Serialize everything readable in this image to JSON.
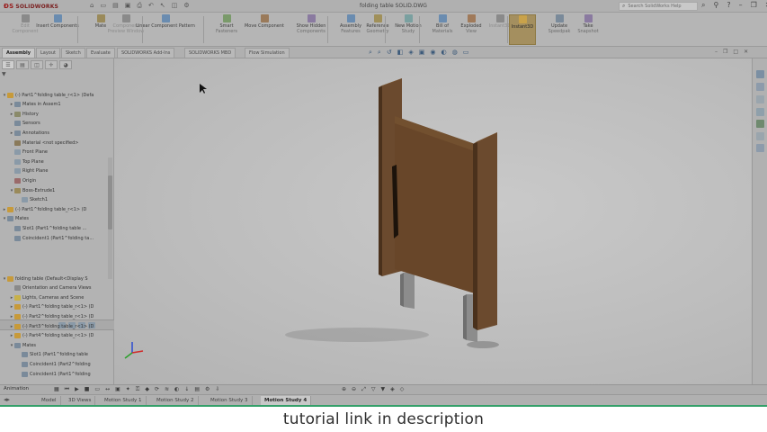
{
  "app": {
    "brand": "SOLIDWORKS",
    "document_title": "folding table SOLID.DWG"
  },
  "search": {
    "placeholder": "Search SolidWorks Help"
  },
  "ribbon": {
    "tools": [
      {
        "label": "Edit",
        "sub": "Component",
        "icon": "edit-component-icon",
        "dim": true
      },
      {
        "label": "Insert Components",
        "sub": "",
        "icon": "insert-components-icon"
      },
      {
        "label": "Mate",
        "sub": "",
        "icon": "mate-icon"
      },
      {
        "label": "Component",
        "sub": "Preview Window",
        "icon": "component-preview-icon",
        "dim": true
      },
      {
        "label": "Linear Component Pattern",
        "sub": "",
        "icon": "linear-pattern-icon"
      },
      {
        "label": "Smart",
        "sub": "Fasteners",
        "icon": "smart-fasteners-icon"
      },
      {
        "label": "Move Component",
        "sub": "",
        "icon": "move-component-icon"
      },
      {
        "label": "Show Hidden",
        "sub": "Components",
        "icon": "show-hidden-icon"
      },
      {
        "label": "Assembly",
        "sub": "Features",
        "icon": "assembly-features-icon"
      },
      {
        "label": "Reference",
        "sub": "Geometry",
        "icon": "reference-geometry-icon"
      },
      {
        "label": "New Motion",
        "sub": "Study",
        "icon": "new-motion-study-icon"
      },
      {
        "label": "Bill of",
        "sub": "Materials",
        "icon": "bom-icon"
      },
      {
        "label": "Exploded",
        "sub": "View",
        "icon": "exploded-view-icon"
      },
      {
        "label": "Instant3D",
        "sub": "",
        "icon": "instant3d-icon",
        "dim": true
      },
      {
        "label": "Instant3D",
        "sub": "",
        "icon": "instant3d-active-icon",
        "active": true
      },
      {
        "label": "Update",
        "sub": "Speedpak",
        "icon": "speedpak-icon"
      },
      {
        "label": "Take",
        "sub": "Snapshot",
        "icon": "snapshot-icon"
      }
    ]
  },
  "command_tabs": [
    "Assembly",
    "Layout",
    "Sketch",
    "Evaluate",
    "SOLIDWORKS Add-Ins",
    "SOLIDWORKS MBD",
    "Flow Simulation"
  ],
  "active_command_tab": "Assembly",
  "feature_tree": [
    {
      "label": "(-) Part1^folding table_r<1> (Defa",
      "level": 0,
      "exp": "▾",
      "icon": "#c79a3a"
    },
    {
      "label": "Mates in Assem1",
      "level": 1,
      "exp": "▸",
      "icon": "#7a8a9a"
    },
    {
      "label": "History",
      "level": 1,
      "exp": "▸",
      "icon": "#8a8a6a"
    },
    {
      "label": "Sensors",
      "level": 1,
      "exp": "",
      "icon": "#7a8a9a"
    },
    {
      "label": "Annotations",
      "level": 1,
      "exp": "▸",
      "icon": "#7a8a9a"
    },
    {
      "label": "Material <not specified>",
      "level": 1,
      "exp": "",
      "icon": "#8a7a5a"
    },
    {
      "label": "Front Plane",
      "level": 1,
      "exp": "",
      "icon": "#8a9aa8"
    },
    {
      "label": "Top Plane",
      "level": 1,
      "exp": "",
      "icon": "#8a9aa8"
    },
    {
      "label": "Right Plane",
      "level": 1,
      "exp": "",
      "icon": "#8a9aa8"
    },
    {
      "label": "Origin",
      "level": 1,
      "exp": "",
      "icon": "#9a6a6a"
    },
    {
      "label": "Boss-Extrude1",
      "level": 1,
      "exp": "▾",
      "icon": "#9a8a5a"
    },
    {
      "label": "Sketch1",
      "level": 2,
      "exp": "",
      "icon": "#8a9aa8"
    },
    {
      "label": "(-) Part1^folding table_r<1> (D",
      "level": 0,
      "exp": "▸",
      "icon": "#c79a3a"
    },
    {
      "label": "Mates",
      "level": 0,
      "exp": "▾",
      "icon": "#7a8a9a"
    },
    {
      "label": "Slot1 (Part1^folding table ...",
      "level": 1,
      "exp": "",
      "icon": "#7a8a9a"
    },
    {
      "label": "Coincident1 (Part1^folding ta...",
      "level": 1,
      "exp": "",
      "icon": "#7a8a9a"
    }
  ],
  "motion_tree": [
    {
      "label": "folding table (Default<Display S",
      "level": 0,
      "exp": "▾",
      "icon": "#c79a3a"
    },
    {
      "label": "Orientation and Camera Views",
      "level": 1,
      "exp": "",
      "icon": "#8a8a8a"
    },
    {
      "label": "Lights, Cameras and Scene",
      "level": 1,
      "exp": "▸",
      "icon": "#c7b14a"
    },
    {
      "label": "(-) Part1^folding table_r<1> (D",
      "level": 1,
      "exp": "▸",
      "icon": "#c79a3a"
    },
    {
      "label": "(-) Part2^folding table_r<1> (D",
      "level": 1,
      "exp": "▸",
      "icon": "#c79a3a"
    },
    {
      "label": "(-) Part3^folding table_r<1> (D",
      "level": 1,
      "exp": "▸",
      "icon": "#c79a3a"
    },
    {
      "label": "(-) Part4^folding table_r<1> (D",
      "level": 1,
      "exp": "▸",
      "icon": "#c79a3a"
    },
    {
      "label": "Mates",
      "level": 1,
      "exp": "▾",
      "icon": "#7a8a9a"
    },
    {
      "label": "Slot1 (Part1^folding table",
      "level": 2,
      "exp": "",
      "icon": "#7a8a9a"
    },
    {
      "label": "Coincident1 (Part2^folding",
      "level": 2,
      "exp": "",
      "icon": "#7a8a9a"
    },
    {
      "label": "Coincident1 (Part1^folding",
      "level": 2,
      "exp": "",
      "icon": "#7a8a9a"
    }
  ],
  "bottom_tabs": [
    "Model",
    "3D Views",
    "Motion Study 1",
    "Motion Study 2",
    "Motion Study 3",
    "Motion Study 4"
  ],
  "active_bottom_tab": "Motion Study 4",
  "bottom_left_label": "Animation",
  "caption": "tutorial link in description",
  "colors": {
    "wood": "#6b4a2e",
    "wood_dark": "#4a311c",
    "leg": "#8c8c8c",
    "accent_green": "#35a06a"
  }
}
